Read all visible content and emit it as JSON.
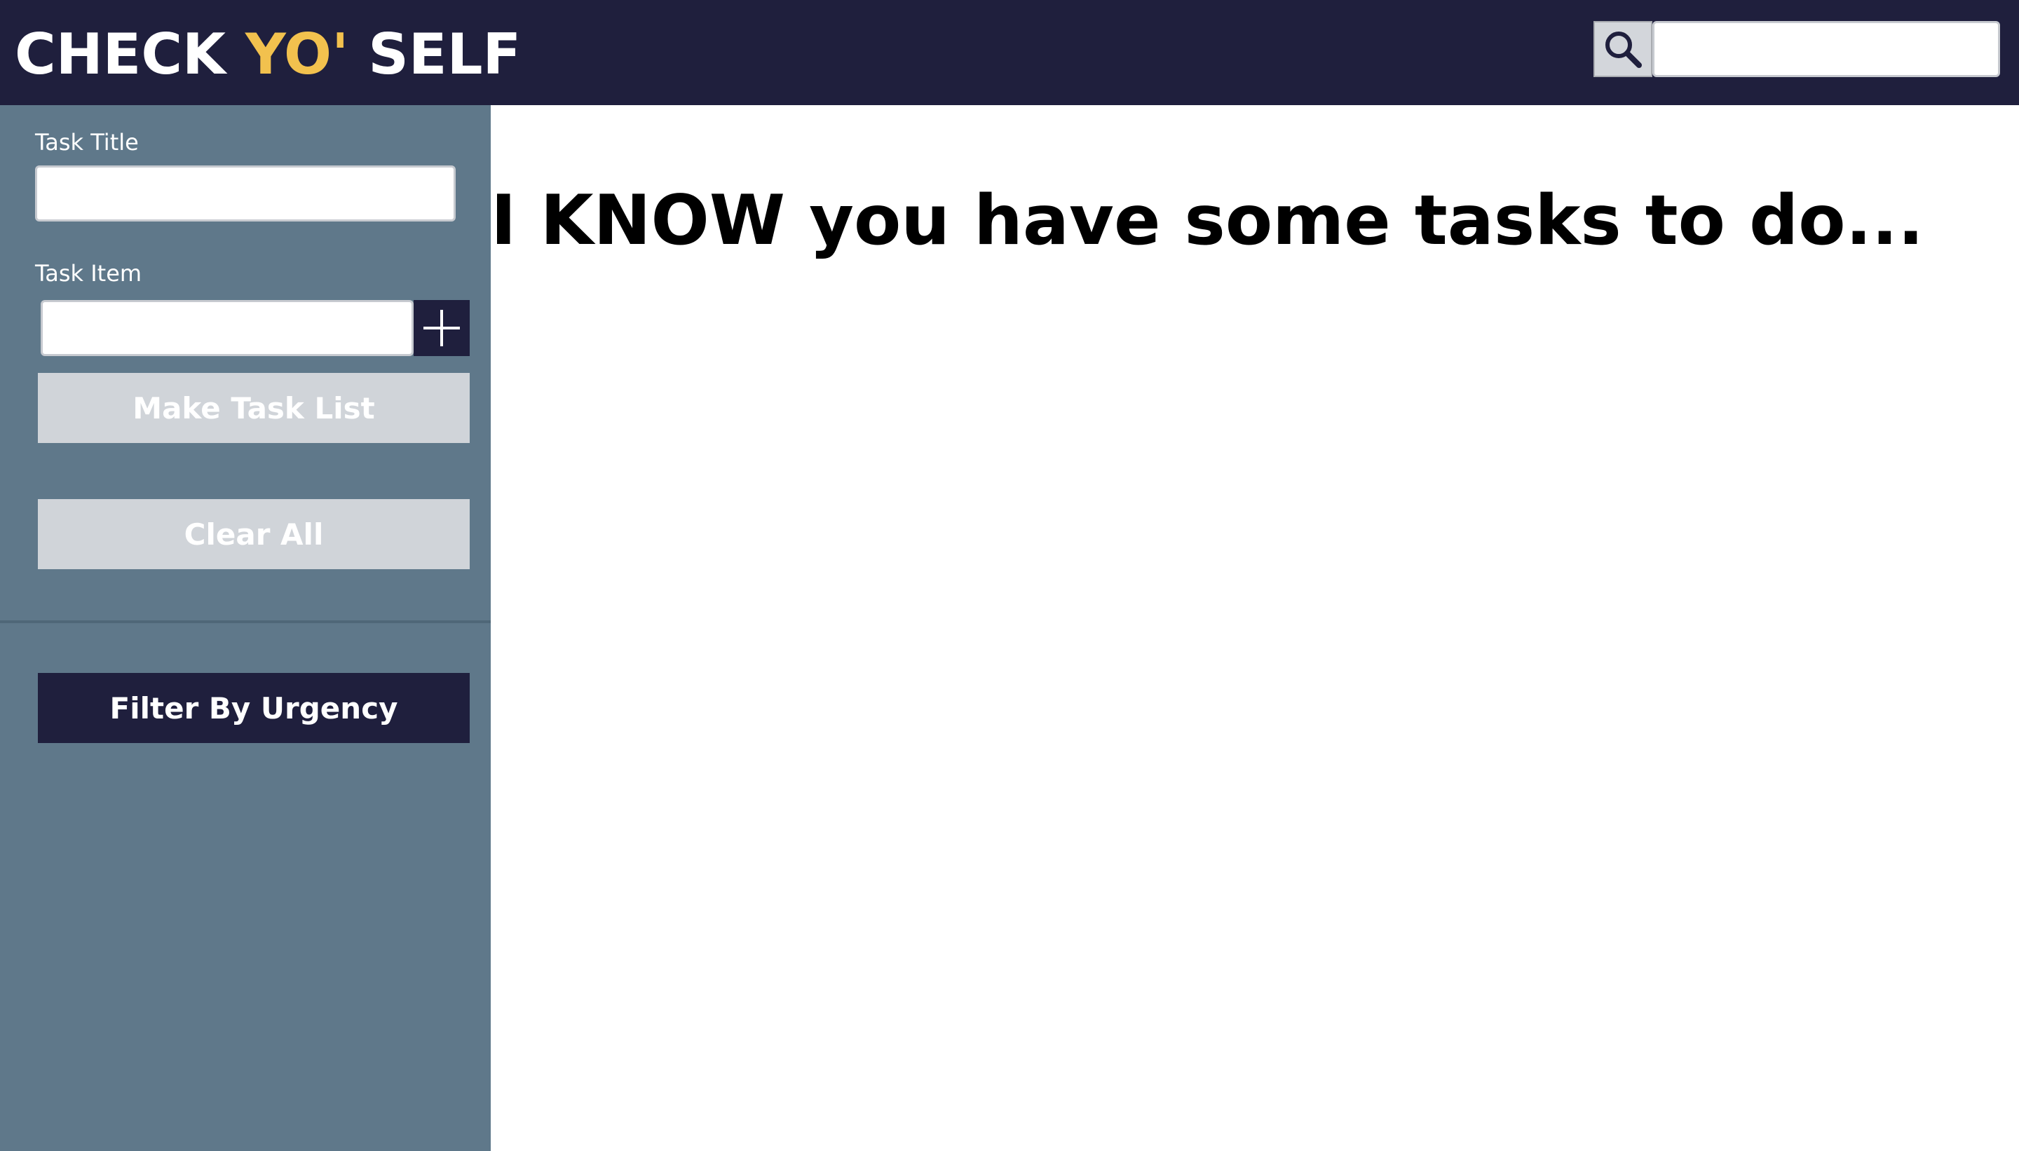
{
  "app": {
    "logo_part1": "CHECK ",
    "logo_accent": "YO'",
    "logo_part2": " SELF"
  },
  "header": {
    "search_icon": "search-icon",
    "search_placeholder": "",
    "search_value": ""
  },
  "sidebar": {
    "task_title_label": "Task Title",
    "task_title_value": "",
    "task_item_label": "Task Item",
    "task_item_value": "",
    "add_icon": "plus-icon",
    "make_task_list_label": "Make Task List",
    "clear_all_label": "Clear All",
    "filter_label": "Filter By Urgency"
  },
  "main": {
    "headline": "I KNOW you have some tasks to do..."
  },
  "colors": {
    "header_bg": "#1f1f3d",
    "accent": "#f2c14e",
    "sidebar_bg": "#5f788a",
    "disabled_button": "#d0d4d9"
  }
}
